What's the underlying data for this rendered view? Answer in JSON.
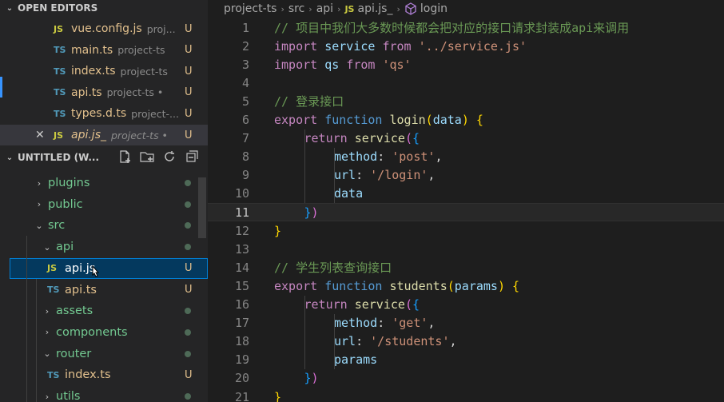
{
  "sidebar": {
    "open_editors_title": "OPEN EDITORS",
    "open_editors": [
      {
        "type": "JS",
        "name": "vue.config.js",
        "desc": "proj...",
        "status": "U",
        "active": false
      },
      {
        "type": "TS",
        "name": "main.ts",
        "desc": "project-ts",
        "status": "U",
        "active": false
      },
      {
        "type": "TS",
        "name": "index.ts",
        "desc": "project-ts",
        "status": "U",
        "active": false
      },
      {
        "type": "TS",
        "name": "api.ts",
        "desc": "project-ts • s...",
        "status": "U",
        "active": false
      },
      {
        "type": "TS",
        "name": "types.d.ts",
        "desc": "project-...",
        "status": "U",
        "active": false
      },
      {
        "type": "JS",
        "name": "api.js_",
        "desc": "project-ts • ...",
        "status": "U",
        "active": true,
        "close": "✕"
      }
    ],
    "workspace_title": "UNTITLED (W...",
    "tree": [
      {
        "kind": "folder",
        "name": "plugins",
        "chev": "›",
        "indent": 1
      },
      {
        "kind": "folder",
        "name": "public",
        "chev": "›",
        "indent": 1
      },
      {
        "kind": "folder",
        "name": "src",
        "chev": "⌄",
        "indent": 1
      },
      {
        "kind": "folder",
        "name": "api",
        "chev": "⌄",
        "indent": 2
      },
      {
        "kind": "file",
        "type": "JS",
        "name": "api.js",
        "status": "U",
        "indent": 3,
        "selected": true
      },
      {
        "kind": "file",
        "type": "TS",
        "name": "api.ts",
        "status": "U",
        "indent": 3
      },
      {
        "kind": "folder",
        "name": "assets",
        "chev": "›",
        "indent": 2
      },
      {
        "kind": "folder",
        "name": "components",
        "chev": "›",
        "indent": 2
      },
      {
        "kind": "folder",
        "name": "router",
        "chev": "⌄",
        "indent": 2
      },
      {
        "kind": "file",
        "type": "TS",
        "name": "index.ts",
        "status": "U",
        "indent": 3
      },
      {
        "kind": "folder",
        "name": "utils",
        "chev": "›",
        "indent": 2
      }
    ]
  },
  "breadcrumb": {
    "items": [
      "project-ts",
      "src",
      "api"
    ],
    "file_type": "JS",
    "file": "api.js_",
    "symbol": "login"
  },
  "editor": {
    "current_line": 11,
    "lines": [
      {
        "n": 1,
        "indent": 0,
        "tokens": [
          [
            "comment",
            "// 项目中我们大多数时候都会把对应的接口请求封装成api来调用"
          ]
        ]
      },
      {
        "n": 2,
        "indent": 0,
        "tokens": [
          [
            "kwc",
            "import"
          ],
          [
            "plain",
            " "
          ],
          [
            "prop",
            "service"
          ],
          [
            "plain",
            " "
          ],
          [
            "kwc",
            "from"
          ],
          [
            "plain",
            " "
          ],
          [
            "str",
            "'../service.js'"
          ]
        ]
      },
      {
        "n": 3,
        "indent": 0,
        "tokens": [
          [
            "kwc",
            "import"
          ],
          [
            "plain",
            " "
          ],
          [
            "prop",
            "qs"
          ],
          [
            "plain",
            " "
          ],
          [
            "kwc",
            "from"
          ],
          [
            "plain",
            " "
          ],
          [
            "str",
            "'qs'"
          ]
        ]
      },
      {
        "n": 4,
        "indent": 0,
        "tokens": []
      },
      {
        "n": 5,
        "indent": 0,
        "tokens": [
          [
            "comment",
            "// 登录接口"
          ]
        ]
      },
      {
        "n": 6,
        "indent": 0,
        "tokens": [
          [
            "kwc",
            "export"
          ],
          [
            "plain",
            " "
          ],
          [
            "kwb",
            "function"
          ],
          [
            "plain",
            " "
          ],
          [
            "fn",
            "login"
          ],
          [
            "br1",
            "("
          ],
          [
            "prop",
            "data"
          ],
          [
            "br1",
            ")"
          ],
          [
            "plain",
            " "
          ],
          [
            "br1",
            "{"
          ]
        ]
      },
      {
        "n": 7,
        "indent": 1,
        "tokens": [
          [
            "kwc",
            "return"
          ],
          [
            "plain",
            " "
          ],
          [
            "fn",
            "service"
          ],
          [
            "br2",
            "("
          ],
          [
            "br3",
            "{"
          ]
        ]
      },
      {
        "n": 8,
        "indent": 2,
        "tokens": [
          [
            "prop",
            "method"
          ],
          [
            "plain",
            ": "
          ],
          [
            "str",
            "'post'"
          ],
          [
            "plain",
            ","
          ]
        ]
      },
      {
        "n": 9,
        "indent": 2,
        "tokens": [
          [
            "prop",
            "url"
          ],
          [
            "plain",
            ": "
          ],
          [
            "str",
            "'/login'"
          ],
          [
            "plain",
            ","
          ]
        ]
      },
      {
        "n": 10,
        "indent": 2,
        "tokens": [
          [
            "prop",
            "data"
          ]
        ]
      },
      {
        "n": 11,
        "indent": 1,
        "tokens": [
          [
            "br3",
            "}"
          ],
          [
            "br2",
            ")"
          ]
        ]
      },
      {
        "n": 12,
        "indent": 0,
        "tokens": [
          [
            "br1",
            "}"
          ]
        ]
      },
      {
        "n": 13,
        "indent": 0,
        "tokens": []
      },
      {
        "n": 14,
        "indent": 0,
        "tokens": [
          [
            "comment",
            "// 学生列表查询接口"
          ]
        ]
      },
      {
        "n": 15,
        "indent": 0,
        "tokens": [
          [
            "kwc",
            "export"
          ],
          [
            "plain",
            " "
          ],
          [
            "kwb",
            "function"
          ],
          [
            "plain",
            " "
          ],
          [
            "fn",
            "students"
          ],
          [
            "br1",
            "("
          ],
          [
            "prop",
            "params"
          ],
          [
            "br1",
            ")"
          ],
          [
            "plain",
            " "
          ],
          [
            "br1",
            "{"
          ]
        ]
      },
      {
        "n": 16,
        "indent": 1,
        "tokens": [
          [
            "kwc",
            "return"
          ],
          [
            "plain",
            " "
          ],
          [
            "fn",
            "service"
          ],
          [
            "br2",
            "("
          ],
          [
            "br3",
            "{"
          ]
        ]
      },
      {
        "n": 17,
        "indent": 2,
        "tokens": [
          [
            "prop",
            "method"
          ],
          [
            "plain",
            ": "
          ],
          [
            "str",
            "'get'"
          ],
          [
            "plain",
            ","
          ]
        ]
      },
      {
        "n": 18,
        "indent": 2,
        "tokens": [
          [
            "prop",
            "url"
          ],
          [
            "plain",
            ": "
          ],
          [
            "str",
            "'/students'"
          ],
          [
            "plain",
            ","
          ]
        ]
      },
      {
        "n": 19,
        "indent": 2,
        "tokens": [
          [
            "prop",
            "params"
          ]
        ]
      },
      {
        "n": 20,
        "indent": 1,
        "tokens": [
          [
            "br3",
            "}"
          ],
          [
            "br2",
            ")"
          ]
        ]
      },
      {
        "n": 21,
        "indent": 0,
        "tokens": [
          [
            "br1",
            "}"
          ]
        ]
      }
    ]
  },
  "colors": {
    "accent": "#007fd4",
    "untracked": "#e2c08d",
    "folder_modified": "#73c991",
    "js_icon": "#cbcb41",
    "ts_icon": "#519aba"
  }
}
